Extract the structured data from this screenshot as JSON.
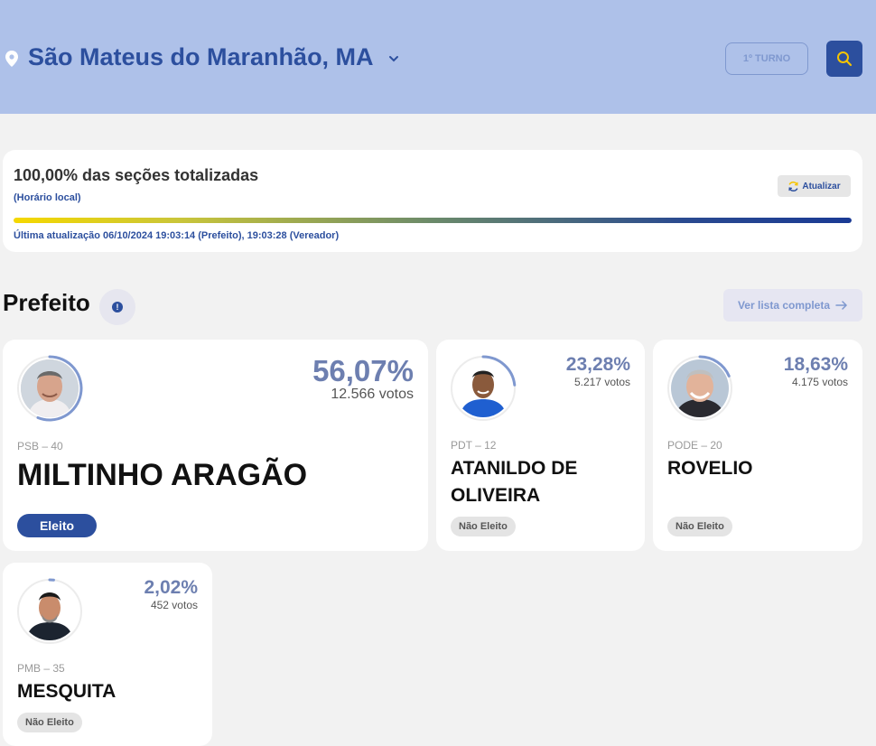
{
  "header": {
    "location": "São Mateus do Maranhão, MA",
    "turno_label": "1º TURNO",
    "pin_icon": "map-pin-icon",
    "search_icon": "search-icon"
  },
  "status": {
    "title": "100,00% das seções totalizadas",
    "subtitle": "(Horário local)",
    "refresh_label": "Atualizar",
    "last_update": "Última atualização 06/10/2024 19:03:14 (Prefeito), 19:03:28 (Vereador)",
    "progress": 1.0
  },
  "section": {
    "title": "Prefeito",
    "list_label": "Ver lista completa"
  },
  "candidates": [
    {
      "name": "MILTINHO ARAGÃO",
      "party": "PSB – 40",
      "pct": "56,07%",
      "votes": "12.566 votos",
      "share": 0.5607,
      "status": "Eleito",
      "elected": true
    },
    {
      "name": "ATANILDO DE OLIVEIRA",
      "party": "PDT – 12",
      "pct": "23,28%",
      "votes": "5.217 votos",
      "share": 0.2328,
      "status": "Não Eleito",
      "elected": false
    },
    {
      "name": "ROVELIO",
      "party": "PODE – 20",
      "pct": "18,63%",
      "votes": "4.175 votos",
      "share": 0.1863,
      "status": "Não Eleito",
      "elected": false
    },
    {
      "name": "MESQUITA",
      "party": "PMB – 35",
      "pct": "2,02%",
      "votes": "452 votos",
      "share": 0.0202,
      "status": "Não Eleito",
      "elected": false
    }
  ],
  "colors": {
    "primary": "#2c4f9e",
    "header_bg": "#aec1e9",
    "pct_color": "#6d7fb0",
    "ring": "#7f98cf"
  }
}
